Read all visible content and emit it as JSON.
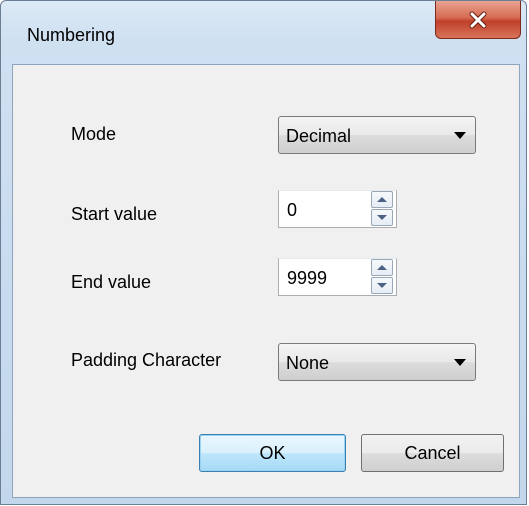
{
  "window": {
    "title": "Numbering"
  },
  "form": {
    "mode_label": "Mode",
    "mode_value": "Decimal",
    "start_label": "Start value",
    "start_value": "0",
    "end_label": "End value",
    "end_value": "9999",
    "padding_label": "Padding Character",
    "padding_value": "None"
  },
  "buttons": {
    "ok": "OK",
    "cancel": "Cancel"
  },
  "icons": {
    "close": "close-x-icon",
    "dropdown": "triangle-down-icon",
    "spin_up": "spin-up-arrow",
    "spin_down": "spin-down-arrow"
  },
  "colors": {
    "close_button": "#c9472f",
    "ok_button_border": "#3c7fb1",
    "client_bg": "#f0f0f0",
    "frame": "#cfe0f1"
  }
}
